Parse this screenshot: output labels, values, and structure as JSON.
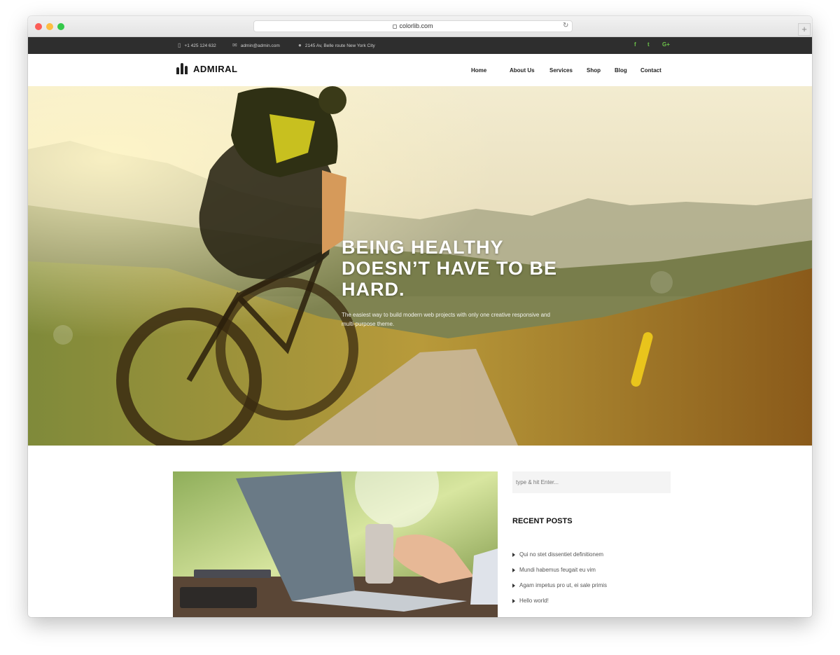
{
  "browser": {
    "url": "colorlib.com",
    "new_tab_label": "+"
  },
  "topbar": {
    "phone": "+1 425 124 632",
    "email": "admin@admin.com",
    "address": "2145 Av, Belle route New York City",
    "social": [
      "f",
      "t",
      "G+"
    ]
  },
  "header": {
    "logo": "ADMIRAL",
    "nav": [
      "Home",
      "About Us",
      "Services",
      "Shop",
      "Blog",
      "Contact"
    ]
  },
  "hero": {
    "title": "BEING HEALTHY DOESN’T HAVE TO BE HARD.",
    "subtitle": "The easiest way to build modern web projects with only one creative responsive and multi-purpose theme."
  },
  "sidebar": {
    "search_placeholder": "type & hit Enter...",
    "recent_title": "RECENT POSTS",
    "recent_posts": [
      "Qui no stet dissentiet definitionem",
      "Mundi habemus feugait eu vim",
      "Agam impetus pro ut, ei sale primis",
      "Hello world!"
    ]
  },
  "colors": {
    "topbar_bg": "#2e2e2e",
    "accent": "#6cc24a",
    "hero_tone": "#c59a2c"
  }
}
